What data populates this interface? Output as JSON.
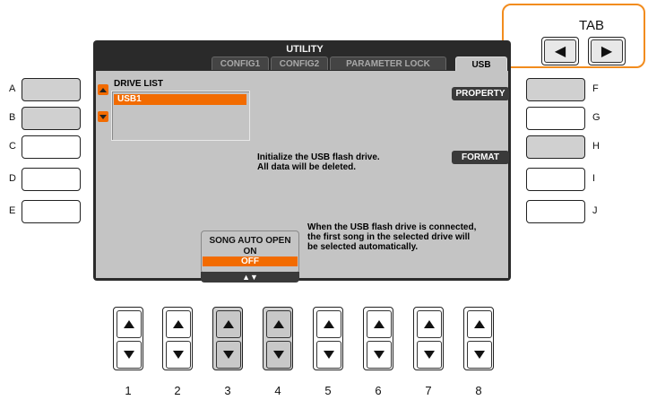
{
  "screen": {
    "title": "UTILITY",
    "tabs": [
      "CONFIG1",
      "CONFIG2",
      "PARAMETER LOCK",
      "USB"
    ],
    "active_tab": "USB",
    "drive_list_label": "DRIVE LIST",
    "drive_items": [
      "USB1"
    ],
    "property_label": "PROPERTY",
    "format_label": "FORMAT",
    "format_info_line1": "Initialize the USB flash drive.",
    "format_info_line2": "All data will be deleted.",
    "song_auto_open_label": "SONG AUTO OPEN",
    "song_auto_open_on": "ON",
    "song_auto_open_off": "OFF",
    "song_auto_open_selected": "OFF",
    "updown_label": "▲▼",
    "auto_open_info_line1": "When the USB flash drive is connected,",
    "auto_open_info_line2": "the first song in the selected drive will",
    "auto_open_info_line3": "be selected automatically."
  },
  "left_buttons": [
    "A",
    "B",
    "C",
    "D",
    "E"
  ],
  "right_buttons": [
    "F",
    "G",
    "H",
    "I",
    "J"
  ],
  "tab_control": {
    "label": "TAB",
    "left_arrow": "◀",
    "right_arrow": "▶"
  },
  "bottom_buttons": [
    "1",
    "2",
    "3",
    "4",
    "5",
    "6",
    "7",
    "8"
  ],
  "colors": {
    "accent_orange": "#f26b00",
    "callout_orange": "#f28c1e",
    "screen_bg": "#c4c4c4",
    "frame_dark": "#2a2a2a"
  }
}
